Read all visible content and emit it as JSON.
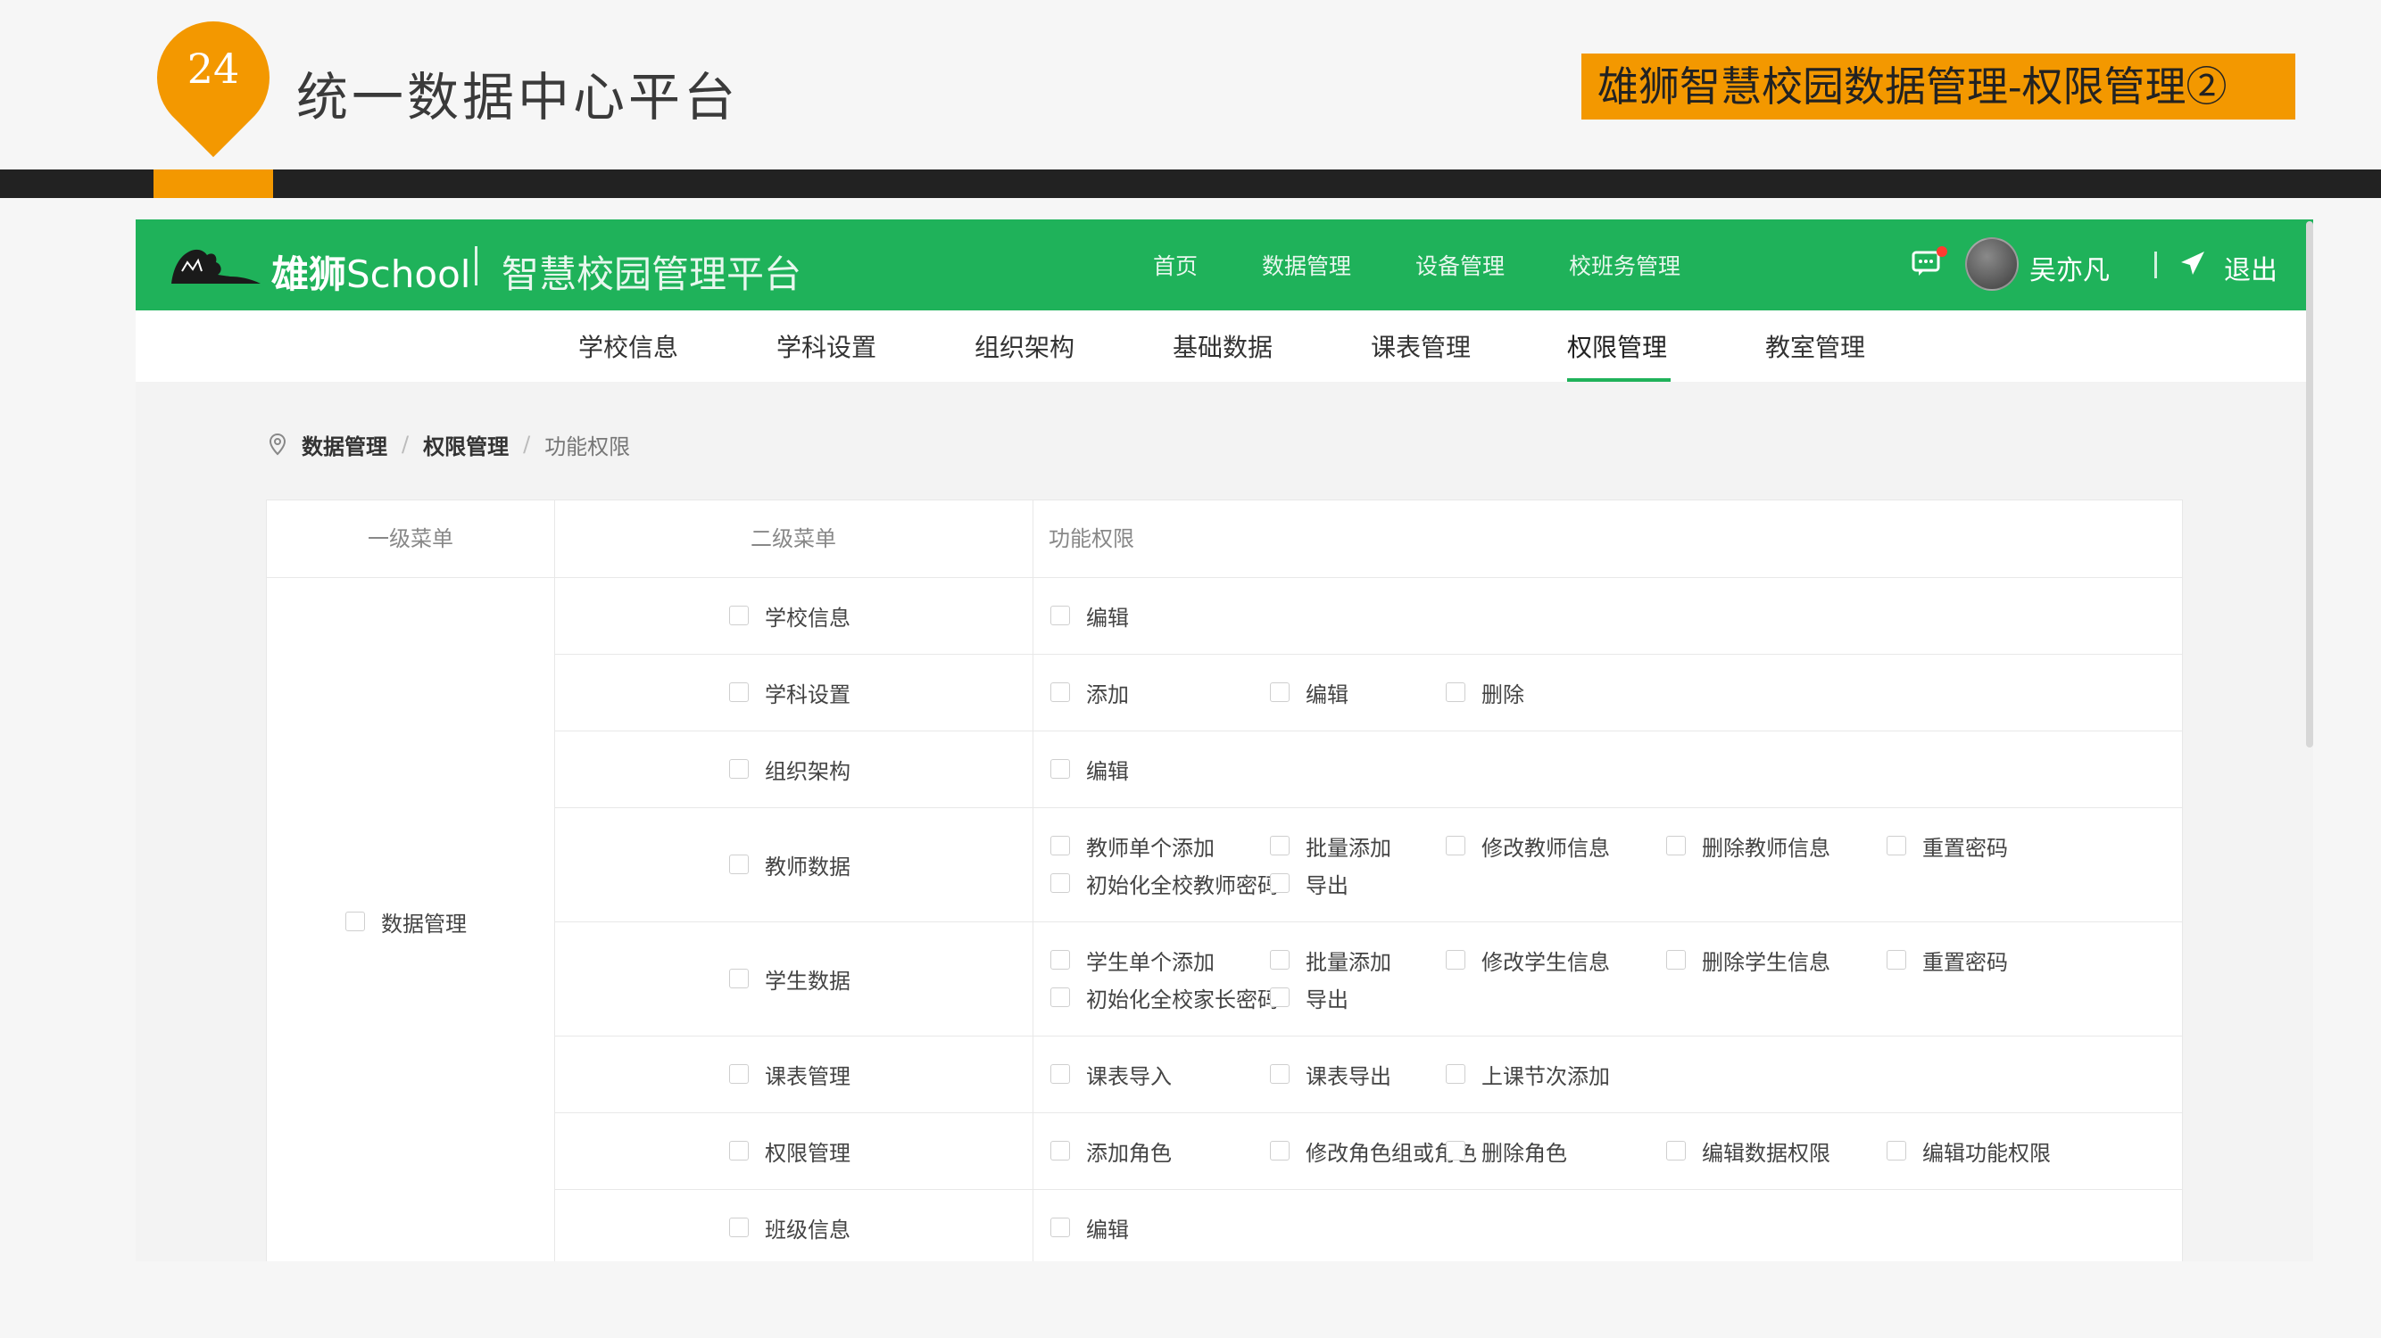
{
  "slide": {
    "number": "24",
    "title": "统一数据中心平台",
    "tag": "雄狮智慧校园数据管理-权限管理②"
  },
  "colors": {
    "accent": "#f39800",
    "primary": "#1fb25a",
    "dark": "#222222"
  },
  "app": {
    "brand_name": "雄狮",
    "brand_school": "School",
    "brand_sub": "智慧校园管理平台",
    "nav": [
      "首页",
      "数据管理",
      "设备管理",
      "校班务管理"
    ],
    "user_name": "吴亦凡",
    "logout": "退出",
    "icons": [
      "lion-logo-icon",
      "message-icon",
      "avatar",
      "send-icon",
      "location-pin-icon"
    ]
  },
  "subnav": {
    "items": [
      "学校信息",
      "学科设置",
      "组织架构",
      "基础数据",
      "课表管理",
      "权限管理",
      "教室管理"
    ],
    "active": "权限管理"
  },
  "breadcrumb": {
    "items": [
      "数据管理",
      "权限管理",
      "功能权限"
    ]
  },
  "table": {
    "headers": [
      "一级菜单",
      "二级菜单",
      "功能权限"
    ],
    "primary_menu": "数据管理",
    "rows": [
      {
        "menu": "学校信息",
        "perms": [
          [
            "编辑"
          ]
        ]
      },
      {
        "menu": "学科设置",
        "perms": [
          [
            "添加",
            "编辑",
            "删除"
          ]
        ]
      },
      {
        "menu": "组织架构",
        "perms": [
          [
            "编辑"
          ]
        ]
      },
      {
        "menu": "教师数据",
        "perms": [
          [
            "教师单个添加",
            "批量添加",
            "修改教师信息",
            "删除教师信息",
            "重置密码"
          ],
          [
            "初始化全校教师密码",
            "导出"
          ]
        ]
      },
      {
        "menu": "学生数据",
        "perms": [
          [
            "学生单个添加",
            "批量添加",
            "修改学生信息",
            "删除学生信息",
            "重置密码"
          ],
          [
            "初始化全校家长密码",
            "导出"
          ]
        ]
      },
      {
        "menu": "课表管理",
        "perms": [
          [
            "课表导入",
            "课表导出",
            "上课节次添加"
          ]
        ]
      },
      {
        "menu": "权限管理",
        "perms": [
          [
            "添加角色",
            "修改角色组或角色",
            "删除角色",
            "编辑数据权限",
            "编辑功能权限"
          ]
        ]
      },
      {
        "menu": "班级信息",
        "perms": [
          [
            "编辑"
          ]
        ]
      }
    ]
  }
}
